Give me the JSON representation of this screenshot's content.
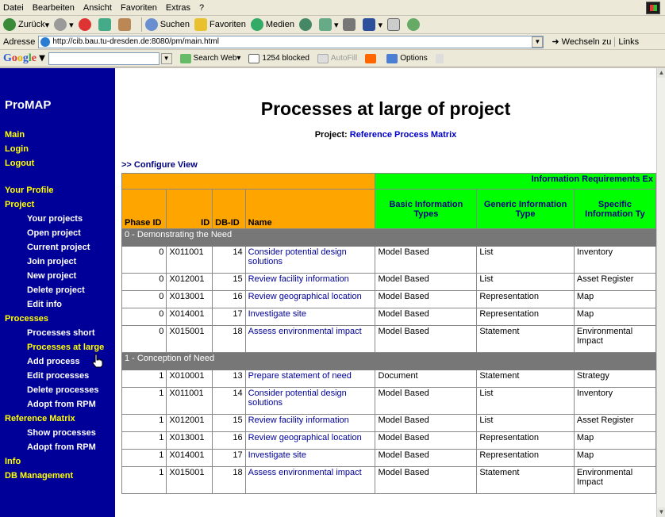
{
  "browser": {
    "menu": [
      "Datei",
      "Bearbeiten",
      "Ansicht",
      "Favoriten",
      "Extras",
      "?"
    ],
    "toolbar": {
      "back": "Zurück",
      "search": "Suchen",
      "favorites": "Favoriten",
      "media": "Medien"
    },
    "address_label": "Adresse",
    "address": "http://cib.bau.tu-dresden.de:8080/pm/main.html",
    "go": "Wechseln zu",
    "links": "Links",
    "google": {
      "logo": "Google",
      "search": "Search Web",
      "blocked": "1254 blocked",
      "autofill": "AutoFill",
      "options": "Options"
    }
  },
  "sidebar": {
    "title": "ProMAP",
    "items": [
      "Main",
      "Login",
      "Logout",
      "Your Profile",
      "Project",
      "Your projects",
      "Open project",
      "Current project",
      "Join project",
      "New project",
      "Delete project",
      "Edit info",
      "Processes",
      "Processes short",
      "Processes at large",
      "Add process",
      "Edit processes",
      "Delete processes",
      "Adopt from RPM",
      "Reference Matrix",
      "Show processes",
      "Adopt from RPM",
      "Info",
      "DB Management"
    ]
  },
  "main": {
    "title": "Processes at large of project",
    "project_label": "Project:",
    "project_name": "Reference Process Matrix",
    "configure": ">> Configure View",
    "info_req_header": "Information Requirements Ex",
    "columns": [
      "Phase ID",
      "ID",
      "DB-ID",
      "Name",
      "Basic Information Types",
      "Generic Information Type",
      "Specific Information Ty"
    ],
    "groups": [
      {
        "label": "0 - Demonstrating the Need",
        "rows": [
          [
            "0",
            "X011001",
            "14",
            "Consider potential design solutions",
            "Model Based",
            "List",
            "Inventory"
          ],
          [
            "0",
            "X012001",
            "15",
            "Review facility information",
            "Model Based",
            "List",
            "Asset Register"
          ],
          [
            "0",
            "X013001",
            "16",
            "Review geographical location",
            "Model Based",
            "Representation",
            "Map"
          ],
          [
            "0",
            "X014001",
            "17",
            "Investigate site",
            "Model Based",
            "Representation",
            "Map"
          ],
          [
            "0",
            "X015001",
            "18",
            "Assess environmental impact",
            "Model Based",
            "Statement",
            "Environmental Impact"
          ]
        ]
      },
      {
        "label": "1 - Conception of Need",
        "rows": [
          [
            "1",
            "X010001",
            "13",
            "Prepare statement of need",
            "Document",
            "Statement",
            "Strategy"
          ],
          [
            "1",
            "X011001",
            "14",
            "Consider potential design solutions",
            "Model Based",
            "List",
            "Inventory"
          ],
          [
            "1",
            "X012001",
            "15",
            "Review facility information",
            "Model Based",
            "List",
            "Asset Register"
          ],
          [
            "1",
            "X013001",
            "16",
            "Review geographical location",
            "Model Based",
            "Representation",
            "Map"
          ],
          [
            "1",
            "X014001",
            "17",
            "Investigate site",
            "Model Based",
            "Representation",
            "Map"
          ],
          [
            "1",
            "X015001",
            "18",
            "Assess environmental impact",
            "Model Based",
            "Statement",
            "Environmental Impact"
          ]
        ]
      }
    ]
  }
}
